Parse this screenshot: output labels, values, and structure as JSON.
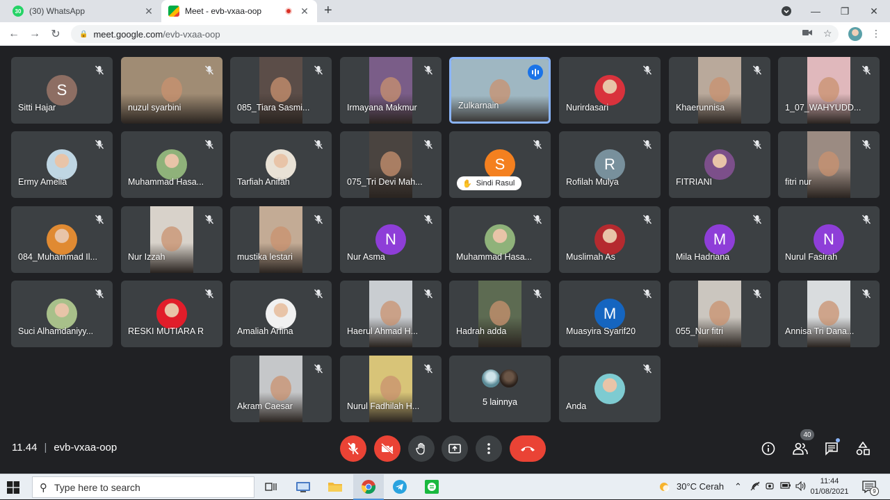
{
  "browser": {
    "tabs": [
      {
        "title": "(30) WhatsApp",
        "favicon": "whatsapp-icon",
        "favicon_text": "30",
        "color": "#25d366"
      },
      {
        "title": "Meet - evb-vxaa-oop",
        "favicon": "meet-icon",
        "color": "#00897b"
      }
    ],
    "url_host": "meet.google.com",
    "url_path": "/evb-vxaa-oop"
  },
  "tiles": [
    {
      "name": "Sitti Hajar",
      "type": "avatar",
      "letter": "S",
      "color": "#8d6e63"
    },
    {
      "name": "nuzul syarbini",
      "type": "video",
      "bg": "#a08c74"
    },
    {
      "name": "085_Tiara Sasmi...",
      "type": "video",
      "bg": "#5b4d48"
    },
    {
      "name": "Irmayana Makmur",
      "type": "video",
      "bg": "#7a5d88"
    },
    {
      "name": "Zulkarnain",
      "type": "video",
      "bg": "#9fb7c2",
      "speaking": true
    },
    {
      "name": "Nurirdasari",
      "type": "photo",
      "color": "#d9323c"
    },
    {
      "name": "Khaerunnisa",
      "type": "video",
      "bg": "#b9a99b"
    },
    {
      "name": "1_07_WAHYUDD...",
      "type": "video",
      "bg": "#e0b8bc"
    },
    {
      "name": "Ermy Amelia",
      "type": "photo",
      "color": "#bfd6e3"
    },
    {
      "name": "Muhammad Hasa...",
      "type": "photo",
      "color": "#8fb27a"
    },
    {
      "name": "Tarfiah Anifah",
      "type": "photo",
      "color": "#e9e2d6"
    },
    {
      "name": "075_Tri Devi Mah...",
      "type": "video",
      "bg": "#4a4440"
    },
    {
      "name": "Sindi Rasul",
      "type": "avatar",
      "letter": "S",
      "color": "#f4801f",
      "hand": true
    },
    {
      "name": "Rofilah Mulya",
      "type": "avatar",
      "letter": "R",
      "color": "#78909c"
    },
    {
      "name": "FITRIANI",
      "type": "photo",
      "color": "#7c4f8a"
    },
    {
      "name": "fitri nur",
      "type": "video",
      "bg": "#9b8b82"
    },
    {
      "name": "084_Muhammad Il...",
      "type": "photo",
      "color": "#e08a32"
    },
    {
      "name": "Nur Izzah",
      "type": "video",
      "bg": "#d8d2ca"
    },
    {
      "name": "mustika lestari",
      "type": "video",
      "bg": "#c3ab95"
    },
    {
      "name": "Nur Asma",
      "type": "avatar",
      "letter": "N",
      "color": "#8e3ed8"
    },
    {
      "name": "Muhammad Hasa...",
      "type": "photo",
      "color": "#8fb27a"
    },
    {
      "name": "Muslimah As",
      "type": "photo",
      "color": "#b52a2f"
    },
    {
      "name": "Mila Hadriana",
      "type": "avatar",
      "letter": "M",
      "color": "#8e3ed8"
    },
    {
      "name": "Nurul Fasirah",
      "type": "avatar",
      "letter": "N",
      "color": "#8e3ed8"
    },
    {
      "name": "Suci Alhamdaniyy...",
      "type": "photo",
      "color": "#a8c08a"
    },
    {
      "name": "RESKI MUTIARA R",
      "type": "photo",
      "color": "#e11d2a"
    },
    {
      "name": "Amaliah Arfina",
      "type": "photo",
      "color": "#f1f1f1"
    },
    {
      "name": "Haerul Ahmad H...",
      "type": "video",
      "bg": "#c9cdd1"
    },
    {
      "name": "Hadrah adda",
      "type": "video",
      "bg": "#5d6b52"
    },
    {
      "name": "Muasyira Syarif20",
      "type": "avatar",
      "letter": "M",
      "color": "#1565c0"
    },
    {
      "name": "055_Nur fitri",
      "type": "video",
      "bg": "#cbc6bf"
    },
    {
      "name": "Annisa Tri Dana...",
      "type": "video",
      "bg": "#d9dcde"
    },
    {
      "name": "Akram Caesar",
      "type": "video",
      "bg": "#c5c7c9"
    },
    {
      "name": "Nurul Fadhilah H...",
      "type": "video",
      "bg": "#d8c478"
    },
    {
      "name": "5 lainnya",
      "type": "more"
    },
    {
      "name": "Anda",
      "type": "photo",
      "color": "#7ecbd1",
      "no_mic": true
    }
  ],
  "meeting": {
    "time": "11.44",
    "code": "evb-vxaa-oop",
    "participants_badge": "40"
  },
  "taskbar": {
    "search_placeholder": "Type here to search",
    "weather": "30°C  Cerah",
    "time": "11:44",
    "date": "01/08/2021",
    "notifications": "9"
  }
}
